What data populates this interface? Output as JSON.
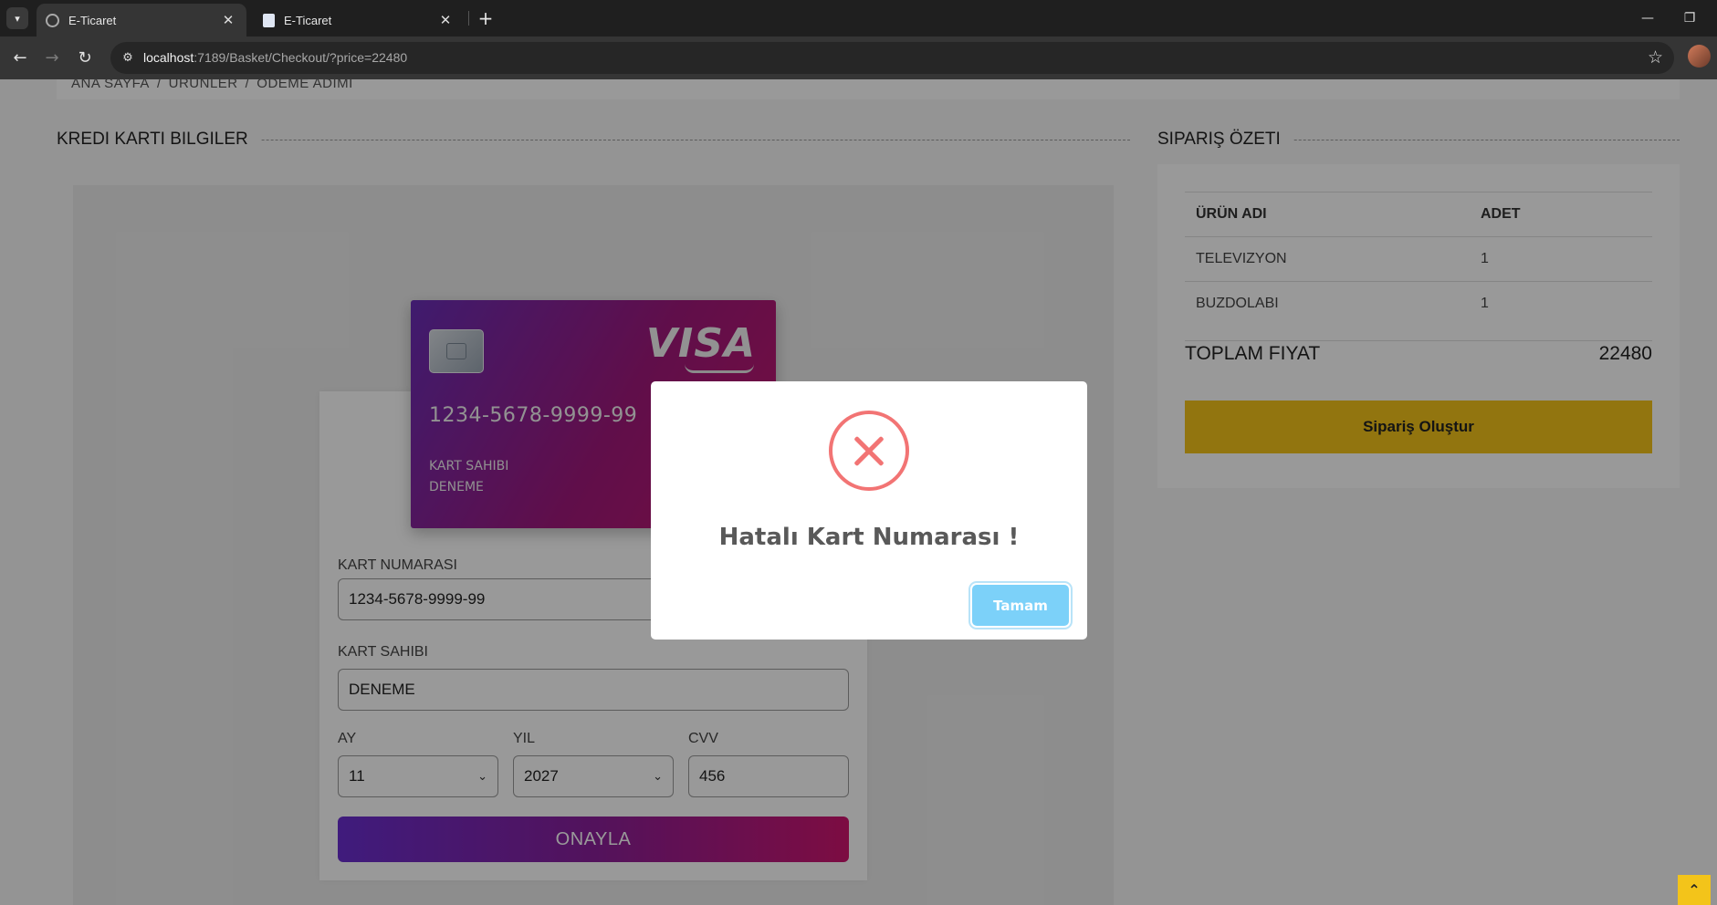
{
  "browser": {
    "tabs": [
      {
        "title": "E-Ticaret",
        "active": true
      },
      {
        "title": "E-Ticaret",
        "active": false
      }
    ],
    "url_host": "localhost",
    "url_rest": ":7189/Basket/Checkout/?price=22480"
  },
  "breadcrumb": [
    "ANA SAYFA",
    "ÜRÜNLER",
    "ÖDEME ADIMI"
  ],
  "payment": {
    "section_title": "KREDI KARTI BILGILER",
    "card_preview": {
      "number": "1234-5678-9999-99",
      "holder_label": "KART SAHIBI",
      "holder": "DENEME",
      "brand": "VISA"
    },
    "fields": {
      "card_number_label": "KART NUMARASI",
      "card_number_value": "1234-5678-9999-99",
      "holder_label": "KART SAHIBI",
      "holder_value": "DENEME",
      "month_label": "AY",
      "month_value": "11",
      "year_label": "YIL",
      "year_value": "2027",
      "cvv_label": "CVV",
      "cvv_value": "456"
    },
    "confirm_label": "ONAYLA"
  },
  "summary": {
    "section_title": "SIPARIŞ ÖZETI",
    "columns": [
      "ÜRÜN ADI",
      "ADET"
    ],
    "rows": [
      {
        "name": "TELEVIZYON",
        "qty": "1"
      },
      {
        "name": "BUZDOLABI",
        "qty": "1"
      }
    ],
    "total_label": "TOPLAM FIYAT",
    "total_value": "22480",
    "order_button": "Sipariş Oluştur"
  },
  "modal": {
    "icon": "error-x-icon",
    "title": "Hatalı Kart Numarası !",
    "ok_label": "Tamam"
  },
  "colors": {
    "accent_yellow": "#f3c41a",
    "card_gradient_start": "#6a2eb8",
    "card_gradient_end": "#c4186d",
    "error_red": "#f27474",
    "ok_button": "#7cd1f9"
  }
}
